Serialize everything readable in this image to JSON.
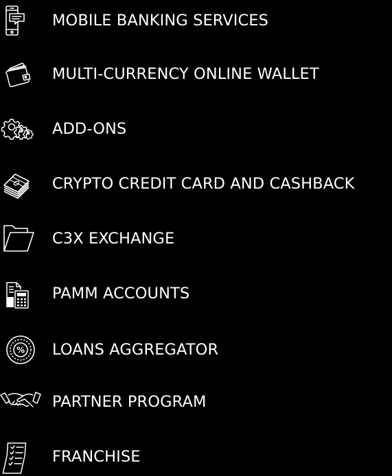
{
  "menu": {
    "items": [
      {
        "label": "MOBILE BANKING SERVICES",
        "icon": "mobile-phone-icon"
      },
      {
        "label": "MULTI-CURRENCY ONLINE WALLET",
        "icon": "wallet-icon"
      },
      {
        "label": "ADD-ONS",
        "icon": "gears-icon"
      },
      {
        "label": "CRYPTO CREDIT CARD AND CASHBACK",
        "icon": "cards-stack-icon"
      },
      {
        "label": "C3X EXCHANGE",
        "icon": "folder-icon"
      },
      {
        "label": "PAMM ACCOUNTS",
        "icon": "documents-calculator-icon"
      },
      {
        "label": "LOANS AGGREGATOR",
        "icon": "percent-dial-icon"
      },
      {
        "label": "PARTNER PROGRAM",
        "icon": "handshake-icon"
      },
      {
        "label": "FRANCHISE",
        "icon": "checklist-icon"
      }
    ]
  },
  "colors": {
    "background": "#000000",
    "text": "#ffffff",
    "icon": "#ffffff"
  }
}
